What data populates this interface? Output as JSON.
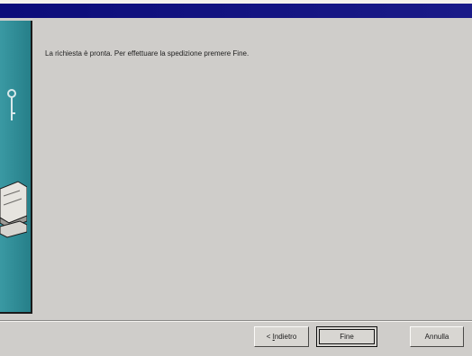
{
  "wizard": {
    "message": "La richiesta è pronta. Per effettuare la spedizione premere Fine."
  },
  "buttons": {
    "back_prefix": "< ",
    "back_mnemonic": "I",
    "back_rest": "ndietro",
    "finish": "Fine",
    "cancel": "Annulla"
  },
  "colors": {
    "title_bar": "#0c0c7a",
    "panel": "#2f8f99",
    "background": "#cfcdca"
  }
}
